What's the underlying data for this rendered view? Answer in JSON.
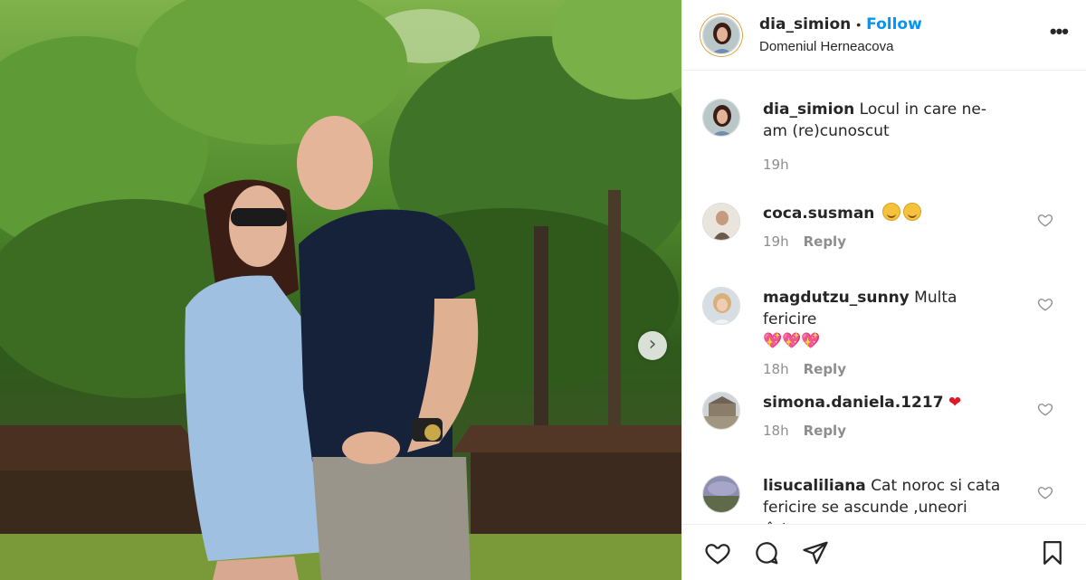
{
  "post": {
    "username": "dia_simion",
    "follow_label": "Follow",
    "location": "Domeniul Herneacova",
    "more_label": "•••"
  },
  "media": {
    "next_glyph": "›"
  },
  "caption": {
    "username": "dia_simion",
    "text": "Locul in care ne-am (re)cunoscut",
    "time": "19h"
  },
  "comments": [
    {
      "username": "coca.susman",
      "text": "",
      "emoji": "hug-hug",
      "time": "19h",
      "reply_label": "Reply",
      "avatar_color": "#6b5a4a"
    },
    {
      "username": "magdutzu_sunny",
      "text": "Multa fericire",
      "emoji_line": "💖💖💖",
      "time": "18h",
      "reply_label": "Reply",
      "avatar_color": "#c9a070"
    },
    {
      "username": "simona.daniela.1217",
      "text": "",
      "emoji": "❤",
      "time": "18h",
      "reply_label": "Reply",
      "avatar_color": "#9a9080"
    },
    {
      "username": "lisucaliliana",
      "text": "Cat noroc si cata fericire se ascunde ,uneori ,într-o",
      "time": "",
      "reply_label": "",
      "avatar_color": "#5e6a4a"
    }
  ],
  "icons": {
    "like": "heart-icon",
    "comment": "comment-icon",
    "share": "share-icon",
    "save": "bookmark-icon"
  },
  "colors": {
    "accent": "#0095f6",
    "text": "#262626",
    "muted": "#8e8e8e",
    "heart": "#e0162b"
  }
}
